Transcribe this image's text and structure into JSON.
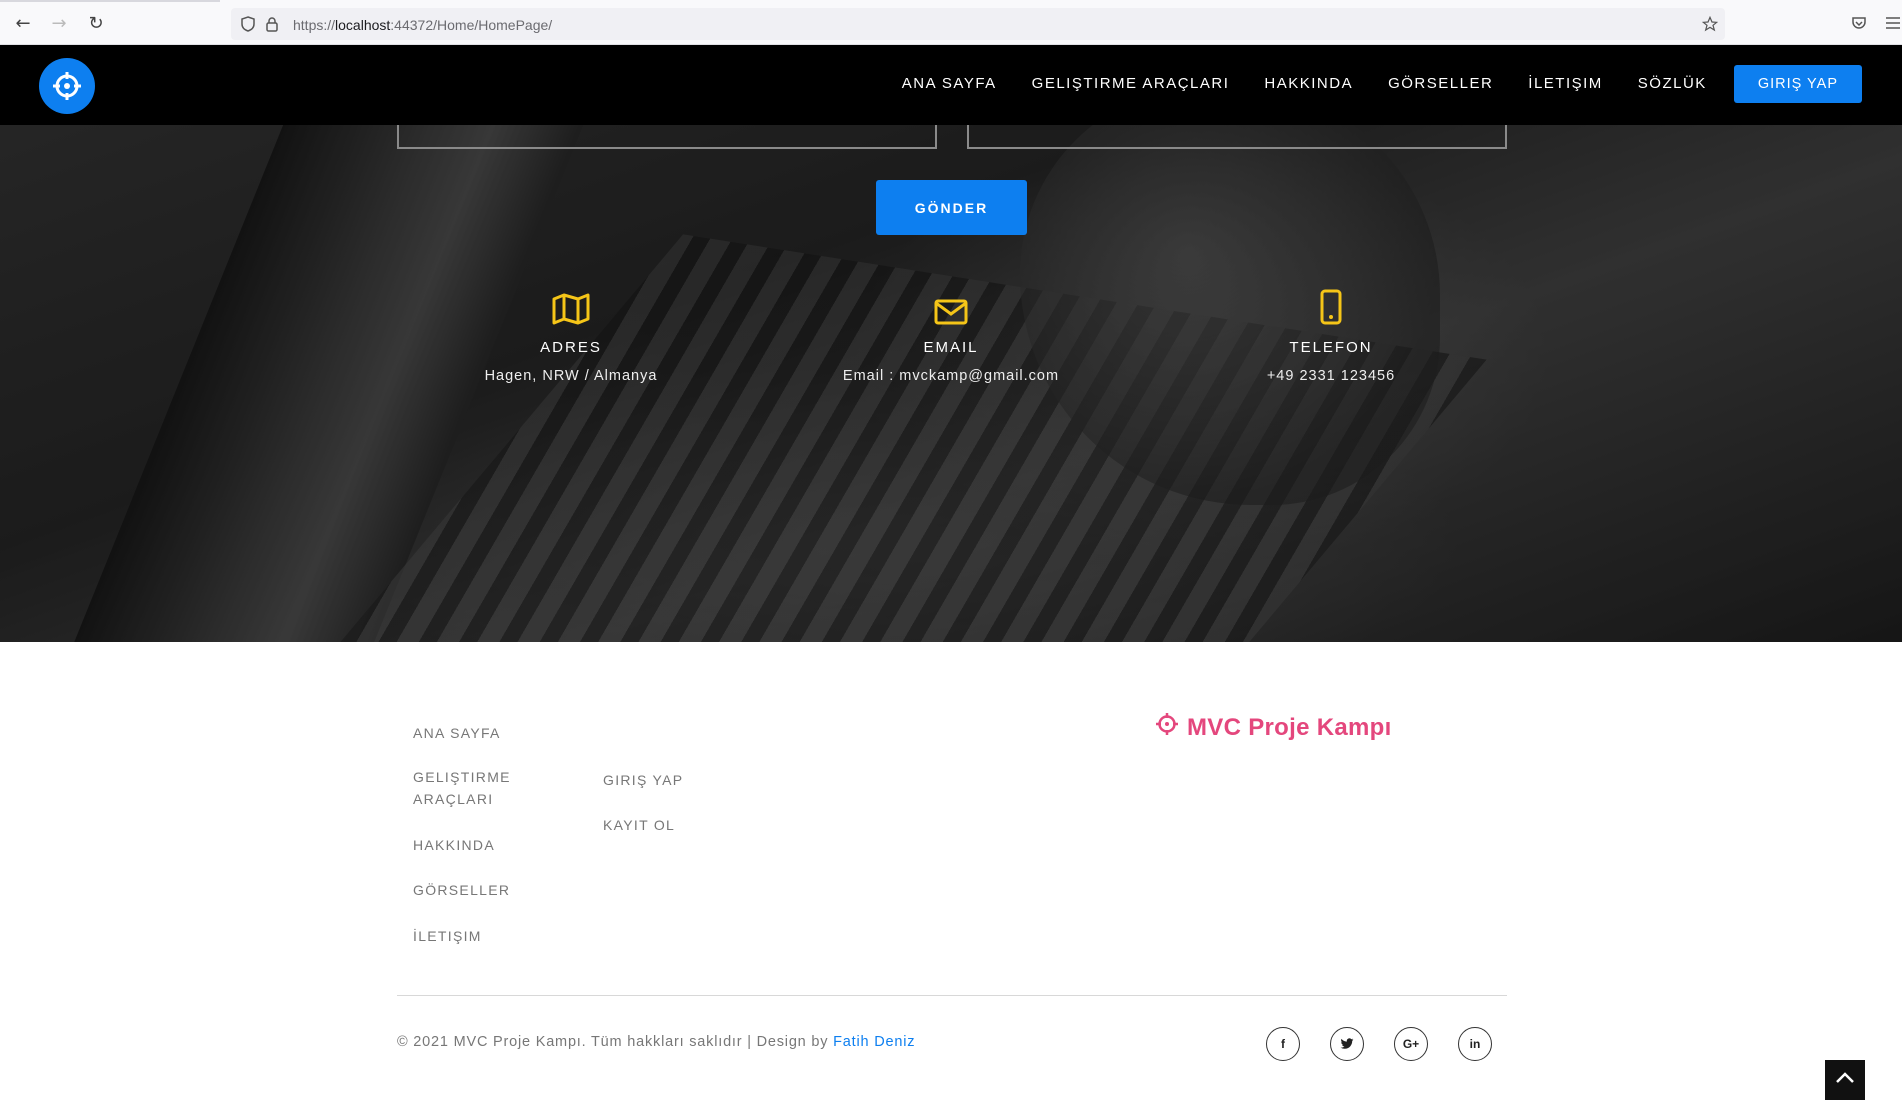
{
  "browser": {
    "url_prefix": "https://",
    "url_host": "localhost",
    "url_rest": ":44372/Home/HomePage/"
  },
  "navbar": {
    "items": [
      "ANA SAYFA",
      "GELIŞTIRME ARAÇLARI",
      "HAKKINDA",
      "GÖRSELLER",
      "İLETIŞIM",
      "SÖZLÜK"
    ],
    "login_label": "GIRIŞ YAP"
  },
  "contact": {
    "send_label": "GÖNDER",
    "address": {
      "title": "ADRES",
      "value": "Hagen, NRW / Almanya",
      "icon": "map-icon"
    },
    "email": {
      "title": "EMAIL",
      "value": "Email : mvckamp@gmail.com",
      "icon": "envelope-icon"
    },
    "phone": {
      "title": "TELEFON",
      "value": "+49 2331 123456",
      "icon": "mobile-phone-icon"
    }
  },
  "footer": {
    "links_col1": [
      "ANA SAYFA",
      "GELIŞTIRME",
      "ARAÇLARI",
      "HAKKINDA",
      "GÖRSELLER",
      "İLETIŞIM"
    ],
    "links_col2": [
      "GIRIŞ YAP",
      "KAYIT OL"
    ],
    "brand": "MVC Proje Kampı",
    "copyright": "© 2021 MVC Proje Kampı. Tüm hakkları saklıdır | Design by ",
    "designer": "Fatih Deniz",
    "social": [
      "facebook-icon",
      "twitter-icon",
      "google-plus-icon",
      "linkedin-icon"
    ]
  },
  "colors": {
    "accent": "#0d7ff0",
    "brand_pink": "#e4477d",
    "icon_yellow": "#f5c518"
  }
}
